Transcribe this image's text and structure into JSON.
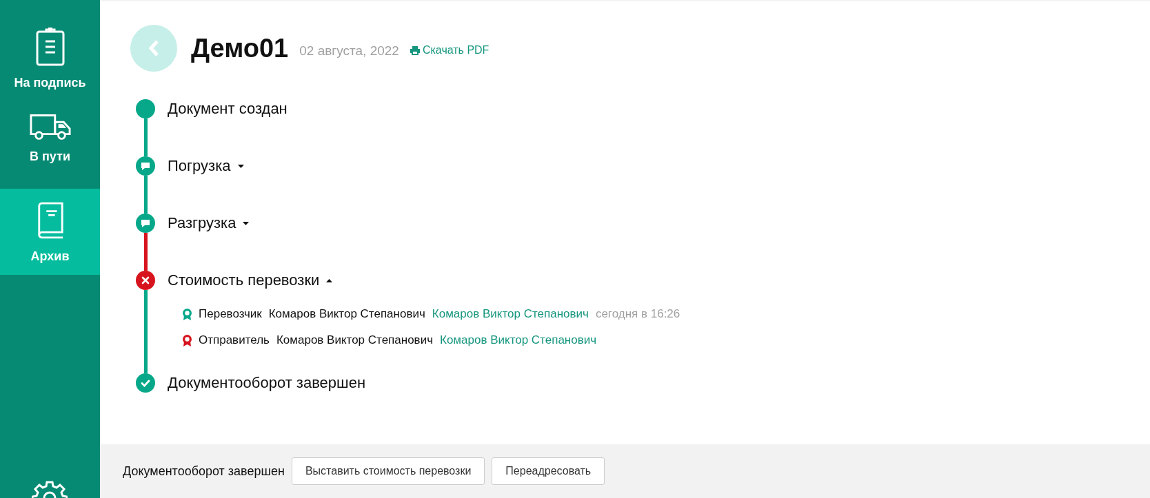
{
  "sidebar": {
    "items": [
      {
        "label": "На подпись",
        "selected": false
      },
      {
        "label": "В пути",
        "selected": false
      },
      {
        "label": "Архив",
        "selected": true
      }
    ]
  },
  "header": {
    "title": "Демо01",
    "date": "02 августа, 2022",
    "pdf_link": "Скачать PDF"
  },
  "timeline": [
    {
      "label": "Документ создан",
      "kind": "done"
    },
    {
      "label": "Погрузка",
      "kind": "comment",
      "expanded": false
    },
    {
      "label": "Разгрузка",
      "kind": "comment",
      "expanded": false
    },
    {
      "label": "Стоимость перевозки",
      "kind": "error",
      "expanded": true,
      "signers": [
        {
          "role": "Перевозчик",
          "name": "Комаров Виктор Степанович",
          "link": "Комаров Виктор Степанович",
          "time": "сегодня в 16:26",
          "color": "#07a88a"
        },
        {
          "role": "Отправитель",
          "name": "Комаров Виктор Степанович",
          "link": "Комаров Виктор Степанович",
          "color": "#d7141e"
        }
      ]
    },
    {
      "label": "Документооборот завершен",
      "kind": "check"
    }
  ],
  "footer": {
    "status": "Документооборот завершен",
    "buttons": [
      "Выставить стоимость перевозки",
      "Переадресовать"
    ]
  }
}
